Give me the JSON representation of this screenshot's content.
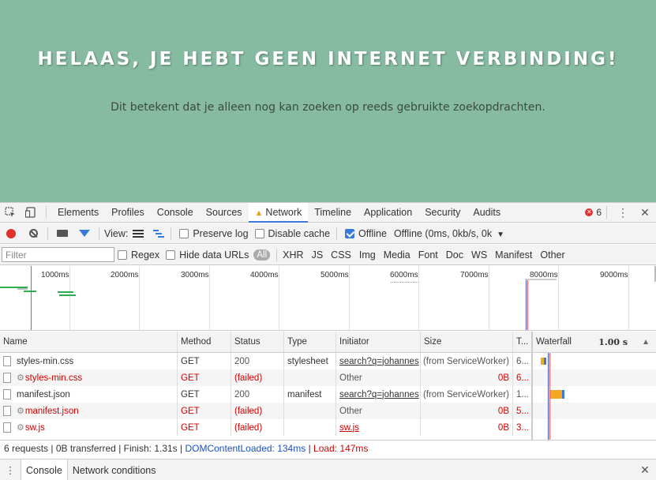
{
  "page": {
    "heading": "HELAAS, JE HEBT GEEN INTERNET VERBINDING!",
    "subtext": "Dit betekent dat je alleen nog kan zoeken op reeds gebruikte zoekopdrachten."
  },
  "devtools": {
    "tabs": [
      "Elements",
      "Profiles",
      "Console",
      "Sources",
      "Network",
      "Timeline",
      "Application",
      "Security",
      "Audits"
    ],
    "active_tab": "Network",
    "error_count": "6",
    "toolbar": {
      "view_label": "View:",
      "preserve_log": "Preserve log",
      "disable_cache": "Disable cache",
      "offline": "Offline",
      "throttle": "Offline (0ms, 0kb/s, 0k"
    },
    "filter": {
      "placeholder": "Filter",
      "regex": "Regex",
      "hide_data_urls": "Hide data URLs",
      "all": "All",
      "types": [
        "XHR",
        "JS",
        "CSS",
        "Img",
        "Media",
        "Font",
        "Doc",
        "WS",
        "Manifest",
        "Other"
      ]
    },
    "overview_ticks": [
      "1000ms",
      "2000ms",
      "3000ms",
      "4000ms",
      "5000ms",
      "6000ms",
      "7000ms",
      "8000ms",
      "9000ms"
    ],
    "columns": {
      "name": "Name",
      "method": "Method",
      "status": "Status",
      "type": "Type",
      "initiator": "Initiator",
      "size": "Size",
      "time": "T...",
      "waterfall": "Waterfall",
      "waterfall_time": "1.00 s"
    },
    "requests": [
      {
        "name": "styles-min.css",
        "method": "GET",
        "status": "200",
        "type": "stylesheet",
        "initiator": "search?q=johannes",
        "size": "(from ServiceWorker)",
        "time": "6...",
        "failed": false
      },
      {
        "name": "styles-min.css",
        "method": "GET",
        "status": "(failed)",
        "type": "",
        "initiator": "Other",
        "size": "0B",
        "time": "6...",
        "failed": true
      },
      {
        "name": "manifest.json",
        "method": "GET",
        "status": "200",
        "type": "manifest",
        "initiator": "search?q=johannes",
        "size": "(from ServiceWorker)",
        "time": "1...",
        "failed": false
      },
      {
        "name": "manifest.json",
        "method": "GET",
        "status": "(failed)",
        "type": "",
        "initiator": "Other",
        "size": "0B",
        "time": "5...",
        "failed": true
      },
      {
        "name": "sw.js",
        "method": "GET",
        "status": "(failed)",
        "type": "",
        "initiator": "sw.js",
        "size": "0B",
        "time": "3...",
        "failed": true
      }
    ],
    "summary": {
      "main": "6 requests | 0B transferred | Finish: 1.31s | ",
      "dcl": "DOMContentLoaded: 134ms",
      "sep": " | ",
      "load": "Load: 147ms"
    },
    "drawer_tabs": [
      "Console",
      "Network conditions"
    ]
  }
}
